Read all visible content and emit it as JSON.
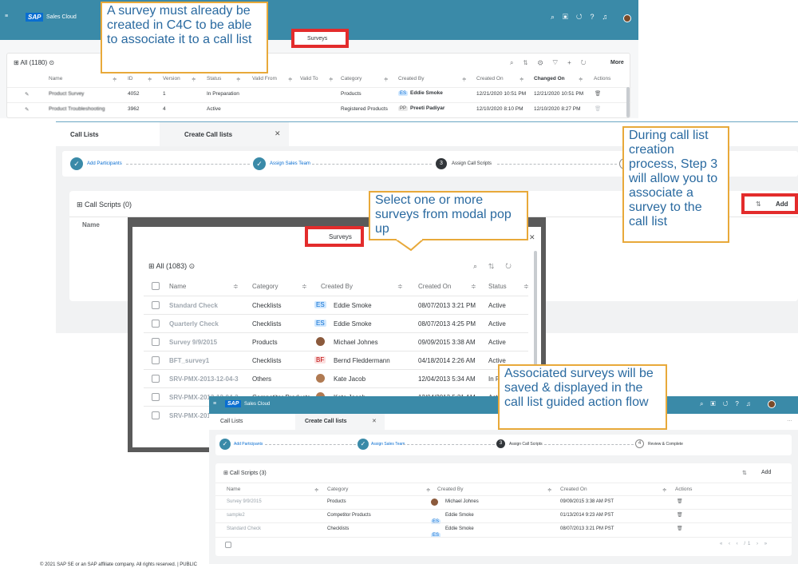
{
  "shell": {
    "logo": "SAP",
    "product": "Sales Cloud",
    "icons": [
      "search-icon",
      "feed-icon",
      "history-icon",
      "help-icon",
      "bell-icon"
    ]
  },
  "top_table": {
    "title": "All (1180)",
    "more_label": "More",
    "columns": [
      "Name",
      "ID",
      "Version",
      "Status",
      "Valid From",
      "Valid To",
      "Category",
      "Created By",
      "Created On",
      "Changed On",
      "Actions"
    ],
    "rows": [
      {
        "name": "Product Survey",
        "id": "4052",
        "version": "1",
        "status": "In Preparation",
        "category": "Products",
        "creator_badge": "ES",
        "created_by": "Eddie Smoke",
        "created_on": "12/21/2020 10:51 PM",
        "changed_on": "12/21/2020 10:51 PM"
      },
      {
        "name": "Product Troubleshooting",
        "id": "3962",
        "version": "4",
        "status": "Active",
        "category": "Registered Products",
        "creator_badge": "PP",
        "created_by": "Preeti Padiyar",
        "created_on": "12/10/2020 8:10 PM",
        "changed_on": "12/10/2020 8:27 PM"
      }
    ]
  },
  "surveys_label": "Surveys",
  "callouts": {
    "one": "A survey must already be created in C4C to be able to  associate it to a call list",
    "two": "Select one or more surveys from modal pop up",
    "three": "During call list creation process, Step 3 will allow you to associate a survey to the call list",
    "four": "Associated surveys will be saved & displayed in the call list guided action flow"
  },
  "tabs": {
    "call_lists": "Call Lists",
    "create": "Create Call lists"
  },
  "steps": {
    "s1": "Add Participants",
    "s2": "Assign Sales Team",
    "s3_num": "3",
    "s3": "Assign Call Scripts",
    "s4_num": "4",
    "s4": "Review & Complete"
  },
  "call_scripts": {
    "title0": "Call Scripts  (0)",
    "title3": "Call Scripts  (3)",
    "name_col": "Name",
    "add_label": "Add"
  },
  "modal": {
    "title": "All  (1083)",
    "columns": [
      "Name",
      "Category",
      "Created By",
      "Created On",
      "Status"
    ],
    "rows": [
      {
        "name": "Standard Check",
        "category": "Checklists",
        "badge": "ES",
        "created_by": "Eddie Smoke",
        "created_on": "08/07/2013 3:21 PM",
        "status": "Active"
      },
      {
        "name": "Quarterly Check",
        "category": "Checklists",
        "badge": "ES",
        "created_by": "Eddie Smoke",
        "created_on": "08/07/2013 4:25 PM",
        "status": "Active"
      },
      {
        "name": "Survey 9/9/2015",
        "category": "Products",
        "badge": "",
        "created_by": "Michael Johnes",
        "created_on": "09/09/2015 3:38 AM",
        "status": "Active"
      },
      {
        "name": "BFT_survey1",
        "category": "Checklists",
        "badge": "BF",
        "created_by": "Bernd Fleddermann",
        "created_on": "04/18/2014 2:26 AM",
        "status": "Active"
      },
      {
        "name": "SRV-PMX-2013-12-04-3",
        "category": "Others",
        "badge": "",
        "created_by": "Kate Jacob",
        "created_on": "12/04/2013 5:34 AM",
        "status": "In P"
      },
      {
        "name": "SRV-PMX-2013-12-04-2",
        "category": "Competitor Products",
        "badge": "",
        "created_by": "Kate Jacob",
        "created_on": "12/04/2013 5:21 AM",
        "status": "Acti"
      },
      {
        "name": "SRV-PMX-2013",
        "category": "",
        "badge": "",
        "created_by": "",
        "created_on": "",
        "status": ""
      }
    ]
  },
  "bottom_table": {
    "columns": [
      "Name",
      "Category",
      "Created By",
      "Created On",
      "Actions"
    ],
    "rows": [
      {
        "name": "Survey 9/9/2015",
        "category": "Products",
        "badge": "",
        "created_by": "Michael Johnes",
        "created_on": "09/09/2015 3:38 AM PST"
      },
      {
        "name": "sample2",
        "category": "Competitor Products",
        "badge": "ES",
        "created_by": "Eddie Smoke",
        "created_on": "01/13/2014 9:23 AM PST"
      },
      {
        "name": "Standard Check",
        "category": "Checklists",
        "badge": "ES",
        "created_by": "Eddie Smoke",
        "created_on": "08/07/2013 3:21 PM PST"
      }
    ],
    "pager": "/1"
  },
  "footer": "© 2021 SAP SE or an SAP affiliate company. All rights reserved. | PUBLIC"
}
